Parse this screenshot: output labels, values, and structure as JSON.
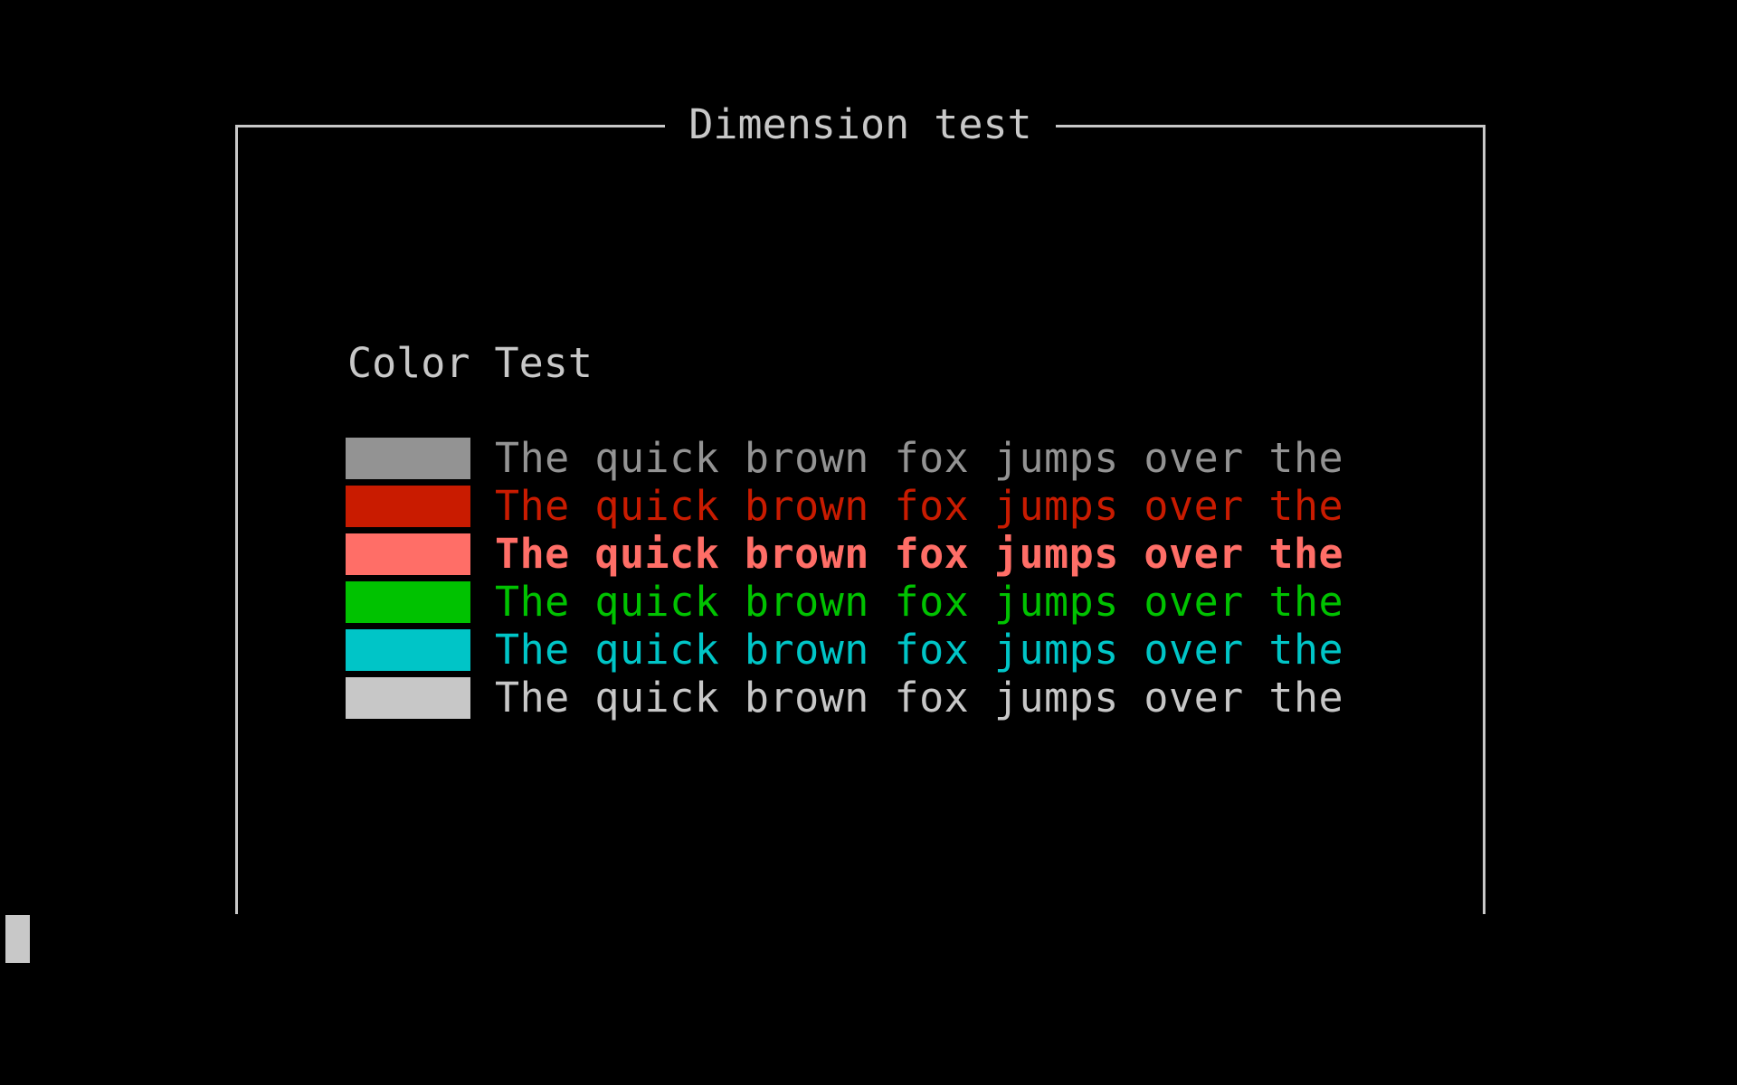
{
  "frame": {
    "title": "Dimension test"
  },
  "section": {
    "title": "Color Test"
  },
  "color_rows": [
    {
      "text": "The quick brown fox jumps over the",
      "color": "#939393",
      "bold": false
    },
    {
      "text": "The quick brown fox jumps over the",
      "color": "#c91b00",
      "bold": false
    },
    {
      "text": "The quick brown fox jumps over the",
      "color": "#ff6e67",
      "bold": true
    },
    {
      "text": "The quick brown fox jumps over the",
      "color": "#00c200",
      "bold": false
    },
    {
      "text": "The quick brown fox jumps over the",
      "color": "#00c5c7",
      "bold": false
    },
    {
      "text": "The quick brown fox jumps over the",
      "color": "#c7c7c7",
      "bold": false
    }
  ],
  "theme": {
    "background": "#000000",
    "foreground": "#c8c8c8",
    "cursor": "#c8c8c8"
  }
}
